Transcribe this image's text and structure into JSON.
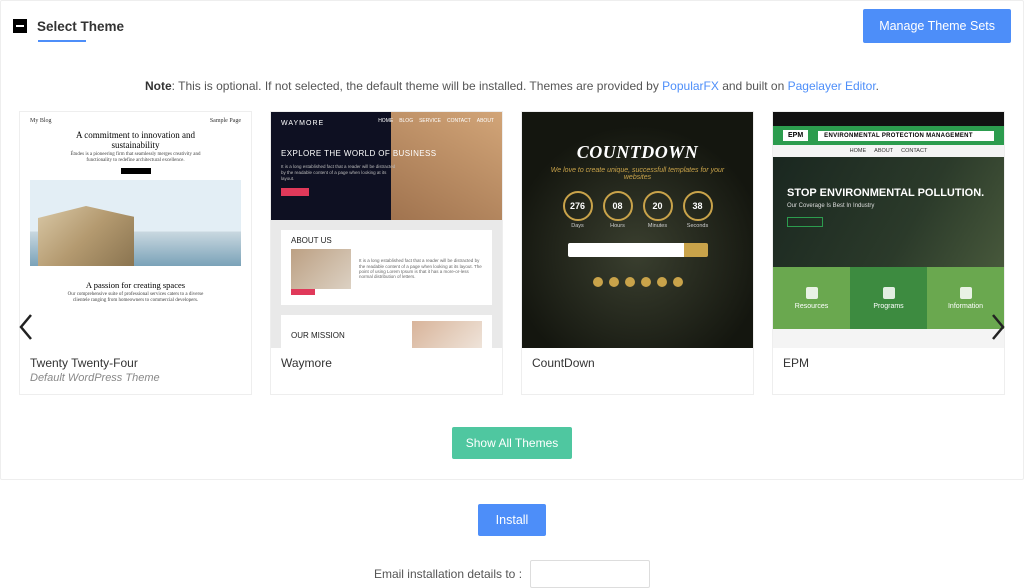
{
  "header": {
    "title": "Select Theme",
    "manage_btn": "Manage Theme Sets"
  },
  "note": {
    "prefix_bold": "Note",
    "text1": ": This is optional. If not selected, the default theme will be installed. Themes are provided by ",
    "link1": "PopularFX",
    "text2": " and built on ",
    "link2": "Pagelayer Editor",
    "text3": "."
  },
  "themes": [
    {
      "name": "Twenty Twenty-Four",
      "subtitle": "Default WordPress Theme"
    },
    {
      "name": "Waymore",
      "subtitle": ""
    },
    {
      "name": "CountDown",
      "subtitle": ""
    },
    {
      "name": "EPM",
      "subtitle": ""
    }
  ],
  "thumbs": {
    "t1": {
      "brand": "My Blog",
      "link": "Sample Page",
      "h1": "A commitment to innovation and sustainability",
      "p": "Études is a pioneering firm that seamlessly merges creativity and functionality to redefine architectural excellence.",
      "h2": "A passion for creating spaces",
      "p2": "Our comprehensive suite of professional services caters to a diverse clientele ranging from homeowners to commercial developers."
    },
    "t2": {
      "brand": "WAYMORE",
      "nav": [
        "HOME",
        "BLOG",
        "SERVICE",
        "CONTACT",
        "ABOUT"
      ],
      "h1": "EXPLORE THE WORLD OF BUSINESS",
      "about": "ABOUT US",
      "mission": "OUR MISSION"
    },
    "t3": {
      "title": "COUNTDOWN",
      "tag": "We love to create unique, successfull templates for your websites",
      "rings": [
        "276",
        "08",
        "20",
        "38"
      ],
      "labels": [
        "Days",
        "Hours",
        "Minutes",
        "Seconds"
      ]
    },
    "t4": {
      "logo": "EPM",
      "title": "ENVIRONMENTAL PROTECTION MANAGEMENT",
      "menu": [
        "HOME",
        "ABOUT",
        "CONTACT"
      ],
      "hero_h1": "STOP ENVIRONMENTAL POLLUTION.",
      "hero_p": "Our Coverage Is Best In Industry",
      "cols": [
        "Resources",
        "Programs",
        "Information"
      ]
    }
  },
  "buttons": {
    "show_all": "Show All Themes",
    "install": "Install"
  },
  "email": {
    "label": "Email installation details to :",
    "value": ""
  }
}
